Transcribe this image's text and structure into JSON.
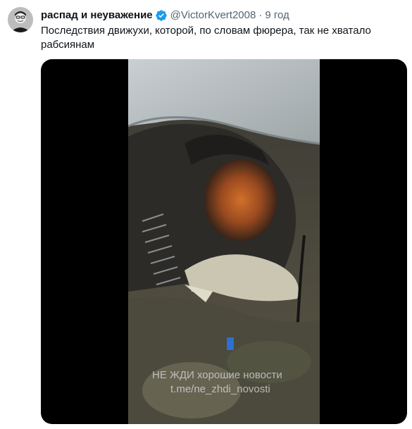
{
  "tweet": {
    "author_name": "распад и неуважение",
    "handle": "@VictorKvert2008",
    "separator": "·",
    "time": "9 год",
    "text": "Последствия движухи, которой, по словам фюрера, так не хватало рабсиянам"
  },
  "media": {
    "watermark_line1": "НЕ ЖДИ хорошие новости",
    "watermark_line2": "t.me/ne_zhdi_novosti"
  },
  "icons": {
    "verified": "verified-badge-icon",
    "verified_color": "#1d9bf0"
  }
}
